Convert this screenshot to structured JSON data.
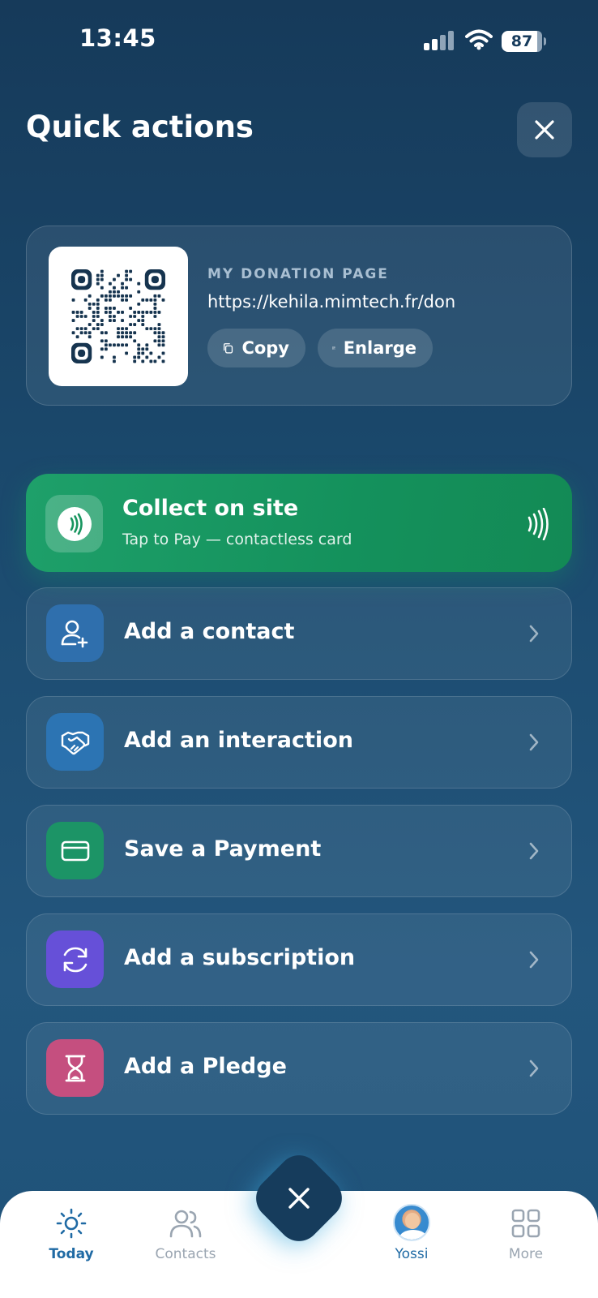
{
  "status_bar": {
    "time": "13:45",
    "battery": "87"
  },
  "header": {
    "title": "Quick actions"
  },
  "donation": {
    "label": "MY DONATION PAGE",
    "url": "https://kehila.mimtech.fr/don",
    "copy_label": "Copy",
    "enlarge_label": "Enlarge"
  },
  "collect": {
    "title": "Collect on site",
    "subtitle": "Tap to Pay — contactless card"
  },
  "actions": [
    {
      "label": "Add a contact",
      "icon": "add-user-icon",
      "color": "#2f6fad"
    },
    {
      "label": "Add an interaction",
      "icon": "handshake-icon",
      "color": "#2c74b3"
    },
    {
      "label": "Save a Payment",
      "icon": "card-icon",
      "color": "#1c9466"
    },
    {
      "label": "Add a subscription",
      "icon": "refresh-icon",
      "color": "#6650d8"
    },
    {
      "label": "Add a Pledge",
      "icon": "hourglass-icon",
      "color": "#c54f7f"
    }
  ],
  "nav": {
    "today": "Today",
    "contacts": "Contacts",
    "profile": "Yossi",
    "more": "More",
    "active_color": "#1f6aa4",
    "inactive_color": "#9aa5b1"
  }
}
